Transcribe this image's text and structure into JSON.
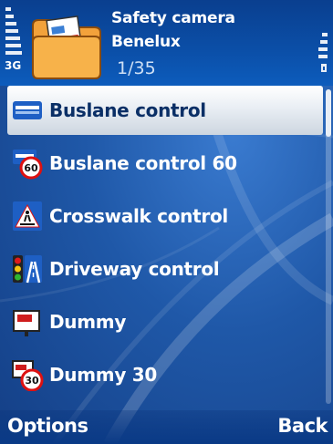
{
  "status": {
    "network": "3G"
  },
  "header": {
    "title_line1": "Safety camera",
    "title_line2": "Benelux",
    "counter": "1/35"
  },
  "list": {
    "items": [
      {
        "label": "Buslane control",
        "icon": "bus-lane-icon",
        "selected": true
      },
      {
        "label": "Buslane control 60",
        "icon": "bus-lane-60-icon",
        "selected": false
      },
      {
        "label": "Crosswalk control",
        "icon": "crosswalk-icon",
        "selected": false
      },
      {
        "label": "Driveway control",
        "icon": "driveway-icon",
        "selected": false
      },
      {
        "label": "Dummy",
        "icon": "dummy-camera-icon",
        "selected": false
      },
      {
        "label": "Dummy 30",
        "icon": "dummy-30-icon",
        "selected": false
      }
    ]
  },
  "softkeys": {
    "left": "Options",
    "right": "Back"
  },
  "colors": {
    "background": "#1f58a8",
    "highlight": "#e9eef4",
    "selected_text": "#0a2f66"
  }
}
